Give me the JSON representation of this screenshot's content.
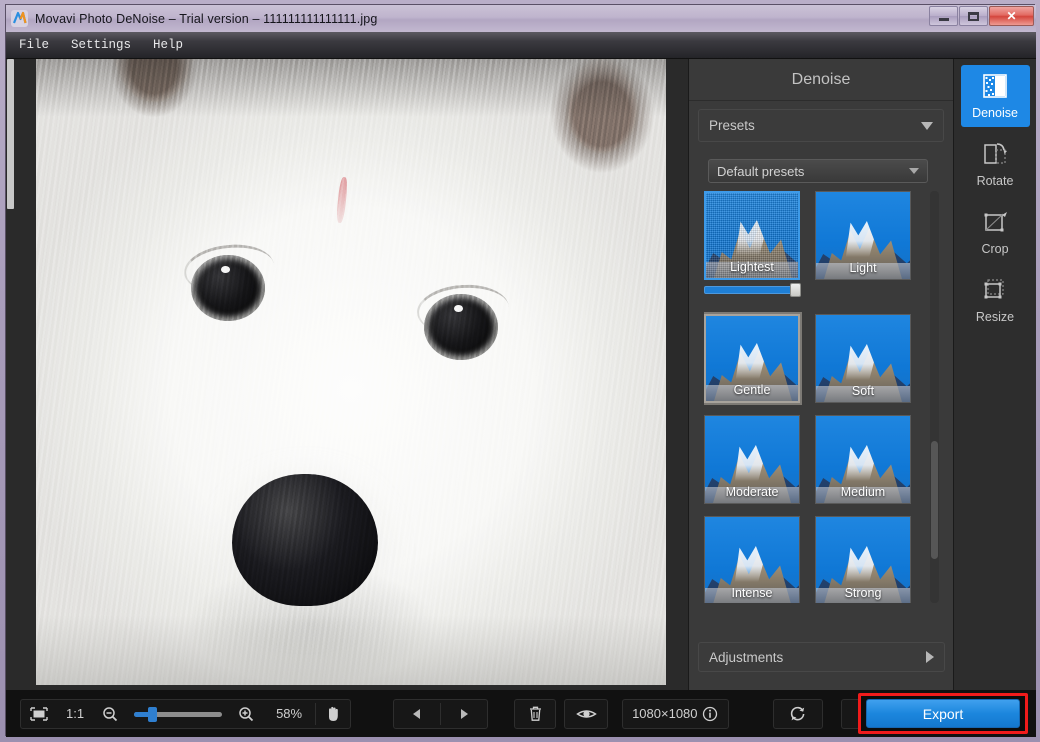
{
  "window": {
    "title": "Movavi Photo DeNoise – Trial version – 111111111111111.jpg",
    "app_icon": "movavi-logo-icon",
    "buttons": {
      "minimize": "minimize-icon",
      "maximize": "maximize-icon",
      "close": "✕"
    }
  },
  "menubar": {
    "items": [
      {
        "label": "File"
      },
      {
        "label": "Settings"
      },
      {
        "label": "Help"
      }
    ]
  },
  "panel": {
    "title": "Denoise",
    "presets_header": "Presets",
    "preset_select_value": "Default presets",
    "adjustments_label": "Adjustments",
    "presets": [
      {
        "label": "Lightest",
        "state": "selected",
        "has_slider": true,
        "slider_value": 100
      },
      {
        "label": "Light",
        "state": "normal",
        "has_slider": false
      },
      {
        "label": "Gentle",
        "state": "hovered",
        "has_slider": false
      },
      {
        "label": "Soft",
        "state": "normal",
        "has_slider": false
      },
      {
        "label": "Moderate",
        "state": "normal",
        "has_slider": false
      },
      {
        "label": "Medium",
        "state": "normal",
        "has_slider": false
      },
      {
        "label": "Intense",
        "state": "normal",
        "has_slider": false
      },
      {
        "label": "Strong",
        "state": "normal",
        "has_slider": false
      }
    ]
  },
  "tools": [
    {
      "label": "Denoise",
      "icon": "denoise-icon",
      "active": true
    },
    {
      "label": "Rotate",
      "icon": "rotate-icon",
      "active": false
    },
    {
      "label": "Crop",
      "icon": "crop-icon",
      "active": false
    },
    {
      "label": "Resize",
      "icon": "resize-icon",
      "active": false
    }
  ],
  "bottombar": {
    "fit_icon": "fit-to-screen-icon",
    "actual_size_label": "1:1",
    "zoom_out_icon": "zoom-out-icon",
    "zoom_in_icon": "zoom-in-icon",
    "zoom_level": "58%",
    "zoom_slider_percent": 16,
    "hand_icon": "hand-tool-icon",
    "prev_icon": "previous-image-icon",
    "next_icon": "next-image-icon",
    "delete_icon": "delete-icon",
    "compare_icon": "compare-eye-icon",
    "dimensions": "1080×1080",
    "info_icon": "info-icon",
    "reset_icon": "reset-icon",
    "undo_icon": "undo-icon",
    "redo_icon": "redo-icon",
    "export_label": "Export"
  },
  "colors": {
    "accent_blue": "#1e88e5",
    "export_blue": "#1c86dd",
    "highlight_red": "#f01b1b",
    "panel_bg": "#3a3a3a",
    "rail_bg": "#2d2d2d",
    "bottombar_bg": "#111111",
    "titlebar_purple": "#bfb4cd"
  }
}
